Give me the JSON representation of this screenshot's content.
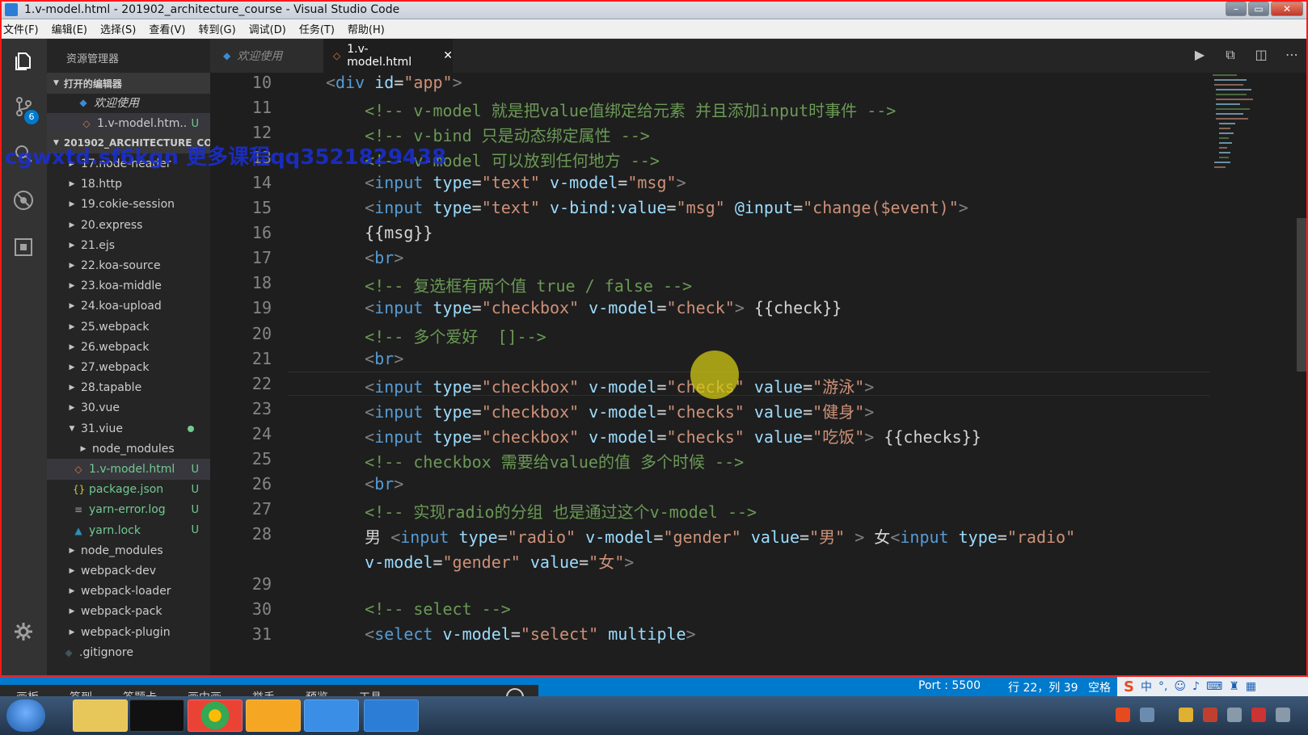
{
  "window": {
    "title": "1.v-model.html - 201902_architecture_course - Visual Studio Code",
    "minimize_glyph": "–",
    "maximize_glyph": "▭",
    "close_glyph": "✕"
  },
  "menu": {
    "items": [
      "文件(F)",
      "编辑(E)",
      "选择(S)",
      "查看(V)",
      "转到(G)",
      "调试(D)",
      "任务(T)",
      "帮助(H)"
    ]
  },
  "activity_bar": {
    "icons": [
      "explorer-icon",
      "source-control-icon",
      "search-icon",
      "debug-icon",
      "extensions-icon",
      "gear-icon"
    ],
    "scm_badge": "6"
  },
  "sidebar": {
    "title": "资源管理器",
    "open_editors_header": "打开的编辑器",
    "open_editors": [
      {
        "label": "欢迎使用",
        "status": ""
      },
      {
        "label": "1.v-model.htm..",
        "status": "U"
      }
    ],
    "workspace_header": "201902_ARCHITECTURE_COU...",
    "tree": [
      {
        "label": "17.node-header",
        "status": "",
        "icon": "folder"
      },
      {
        "label": "18.http",
        "status": "",
        "icon": "folder"
      },
      {
        "label": "19.cokie-session",
        "status": "",
        "icon": "folder"
      },
      {
        "label": "20.express",
        "status": "",
        "icon": "folder"
      },
      {
        "label": "21.ejs",
        "status": "",
        "icon": "folder"
      },
      {
        "label": "22.koa-source",
        "status": "",
        "icon": "folder"
      },
      {
        "label": "23.koa-middle",
        "status": "",
        "icon": "folder"
      },
      {
        "label": "24.koa-upload",
        "status": "",
        "icon": "folder"
      },
      {
        "label": "25.webpack",
        "status": "",
        "icon": "folder"
      },
      {
        "label": "26.webpack",
        "status": "",
        "icon": "folder"
      },
      {
        "label": "27.webpack",
        "status": "",
        "icon": "folder"
      },
      {
        "label": "28.tapable",
        "status": "",
        "icon": "folder"
      },
      {
        "label": "30.vue",
        "status": "",
        "icon": "folder"
      },
      {
        "label": "31.viue",
        "status": "dot",
        "icon": "folder-open"
      },
      {
        "label": "node_modules",
        "status": "",
        "icon": "folder"
      },
      {
        "label": "1.v-model.html",
        "status": "U",
        "icon": "html"
      },
      {
        "label": "package.json",
        "status": "U",
        "icon": "json"
      },
      {
        "label": "yarn-error.log",
        "status": "U",
        "icon": "log"
      },
      {
        "label": "yarn.lock",
        "status": "U",
        "icon": "yarn"
      },
      {
        "label": "node_modules",
        "status": "",
        "icon": "folder"
      },
      {
        "label": "webpack-dev",
        "status": "",
        "icon": "folder"
      },
      {
        "label": "webpack-loader",
        "status": "",
        "icon": "folder"
      },
      {
        "label": "webpack-pack",
        "status": "",
        "icon": "folder"
      },
      {
        "label": "webpack-plugin",
        "status": "",
        "icon": "folder"
      },
      {
        "label": ".gitignore",
        "status": "",
        "icon": "git"
      }
    ]
  },
  "tabs": [
    {
      "label": "欢迎使用",
      "active": false
    },
    {
      "label": "1.v-model.html",
      "active": true,
      "close": "✕"
    }
  ],
  "editor": {
    "line_numbers": [
      "10",
      "11",
      "12",
      "13",
      "14",
      "15",
      "16",
      "17",
      "18",
      "19",
      "20",
      "21",
      "22",
      "23",
      "24",
      "25",
      "26",
      "27",
      "28",
      "",
      "29",
      "30",
      "31"
    ],
    "lines": [
      [
        {
          "t": "pun",
          "v": "<"
        },
        {
          "t": "tag",
          "v": "div"
        },
        {
          "t": "txt",
          "v": " "
        },
        {
          "t": "attr",
          "v": "id"
        },
        {
          "t": "txt",
          "v": "="
        },
        {
          "t": "str",
          "v": "\"app\""
        },
        {
          "t": "pun",
          "v": ">"
        }
      ],
      [
        {
          "t": "txt",
          "v": "    "
        },
        {
          "t": "com",
          "v": "<!-- v-model 就是把value值绑定给元素 并且添加input时事件 -->"
        }
      ],
      [
        {
          "t": "txt",
          "v": "    "
        },
        {
          "t": "com",
          "v": "<!-- v-bind 只是动态绑定属性 -->"
        }
      ],
      [
        {
          "t": "txt",
          "v": "    "
        },
        {
          "t": "com",
          "v": "<!-- v-model 可以放到任何地方 -->"
        }
      ],
      [
        {
          "t": "txt",
          "v": "    "
        },
        {
          "t": "pun",
          "v": "<"
        },
        {
          "t": "tag",
          "v": "input"
        },
        {
          "t": "txt",
          "v": " "
        },
        {
          "t": "attr",
          "v": "type"
        },
        {
          "t": "txt",
          "v": "="
        },
        {
          "t": "str",
          "v": "\"text\""
        },
        {
          "t": "txt",
          "v": " "
        },
        {
          "t": "attr",
          "v": "v-model"
        },
        {
          "t": "txt",
          "v": "="
        },
        {
          "t": "str",
          "v": "\"msg\""
        },
        {
          "t": "pun",
          "v": ">"
        }
      ],
      [
        {
          "t": "txt",
          "v": "    "
        },
        {
          "t": "pun",
          "v": "<"
        },
        {
          "t": "tag",
          "v": "input"
        },
        {
          "t": "txt",
          "v": " "
        },
        {
          "t": "attr",
          "v": "type"
        },
        {
          "t": "txt",
          "v": "="
        },
        {
          "t": "str",
          "v": "\"text\""
        },
        {
          "t": "txt",
          "v": " "
        },
        {
          "t": "attr",
          "v": "v-bind:value"
        },
        {
          "t": "txt",
          "v": "="
        },
        {
          "t": "str",
          "v": "\"msg\""
        },
        {
          "t": "txt",
          "v": " "
        },
        {
          "t": "attr",
          "v": "@input"
        },
        {
          "t": "txt",
          "v": "="
        },
        {
          "t": "str",
          "v": "\"change($event)\""
        },
        {
          "t": "pun",
          "v": ">"
        }
      ],
      [
        {
          "t": "txt",
          "v": "    {{msg}}"
        }
      ],
      [
        {
          "t": "txt",
          "v": "    "
        },
        {
          "t": "pun",
          "v": "<"
        },
        {
          "t": "tag",
          "v": "br"
        },
        {
          "t": "pun",
          "v": ">"
        }
      ],
      [
        {
          "t": "txt",
          "v": "    "
        },
        {
          "t": "com",
          "v": "<!-- 复选框有两个值 true / false -->"
        }
      ],
      [
        {
          "t": "txt",
          "v": "    "
        },
        {
          "t": "pun",
          "v": "<"
        },
        {
          "t": "tag",
          "v": "input"
        },
        {
          "t": "txt",
          "v": " "
        },
        {
          "t": "attr",
          "v": "type"
        },
        {
          "t": "txt",
          "v": "="
        },
        {
          "t": "str",
          "v": "\"checkbox\""
        },
        {
          "t": "txt",
          "v": " "
        },
        {
          "t": "attr",
          "v": "v-model"
        },
        {
          "t": "txt",
          "v": "="
        },
        {
          "t": "str",
          "v": "\"check\""
        },
        {
          "t": "pun",
          "v": ">"
        },
        {
          "t": "txt",
          "v": " {{check}}"
        }
      ],
      [
        {
          "t": "txt",
          "v": "    "
        },
        {
          "t": "com",
          "v": "<!-- 多个爱好  []-->"
        }
      ],
      [
        {
          "t": "txt",
          "v": "    "
        },
        {
          "t": "pun",
          "v": "<"
        },
        {
          "t": "tag",
          "v": "br"
        },
        {
          "t": "pun",
          "v": ">"
        }
      ],
      [
        {
          "t": "txt",
          "v": "    "
        },
        {
          "t": "pun",
          "v": "<"
        },
        {
          "t": "tag",
          "v": "input"
        },
        {
          "t": "txt",
          "v": " "
        },
        {
          "t": "attr",
          "v": "type"
        },
        {
          "t": "txt",
          "v": "="
        },
        {
          "t": "str",
          "v": "\"checkbox\""
        },
        {
          "t": "txt",
          "v": " "
        },
        {
          "t": "attr",
          "v": "v-model"
        },
        {
          "t": "txt",
          "v": "="
        },
        {
          "t": "str",
          "v": "\"checks\""
        },
        {
          "t": "txt",
          "v": " "
        },
        {
          "t": "attr",
          "v": "value"
        },
        {
          "t": "txt",
          "v": "="
        },
        {
          "t": "str",
          "v": "\"游泳\""
        },
        {
          "t": "pun",
          "v": ">"
        }
      ],
      [
        {
          "t": "txt",
          "v": "    "
        },
        {
          "t": "pun",
          "v": "<"
        },
        {
          "t": "tag",
          "v": "input"
        },
        {
          "t": "txt",
          "v": " "
        },
        {
          "t": "attr",
          "v": "type"
        },
        {
          "t": "txt",
          "v": "="
        },
        {
          "t": "str",
          "v": "\"checkbox\""
        },
        {
          "t": "txt",
          "v": " "
        },
        {
          "t": "attr",
          "v": "v-model"
        },
        {
          "t": "txt",
          "v": "="
        },
        {
          "t": "str",
          "v": "\"checks\""
        },
        {
          "t": "txt",
          "v": " "
        },
        {
          "t": "attr",
          "v": "value"
        },
        {
          "t": "txt",
          "v": "="
        },
        {
          "t": "str",
          "v": "\"健身\""
        },
        {
          "t": "pun",
          "v": ">"
        }
      ],
      [
        {
          "t": "txt",
          "v": "    "
        },
        {
          "t": "pun",
          "v": "<"
        },
        {
          "t": "tag",
          "v": "input"
        },
        {
          "t": "txt",
          "v": " "
        },
        {
          "t": "attr",
          "v": "type"
        },
        {
          "t": "txt",
          "v": "="
        },
        {
          "t": "str",
          "v": "\"checkbox\""
        },
        {
          "t": "txt",
          "v": " "
        },
        {
          "t": "attr",
          "v": "v-model"
        },
        {
          "t": "txt",
          "v": "="
        },
        {
          "t": "str",
          "v": "\"checks\""
        },
        {
          "t": "txt",
          "v": " "
        },
        {
          "t": "attr",
          "v": "value"
        },
        {
          "t": "txt",
          "v": "="
        },
        {
          "t": "str",
          "v": "\"吃饭\""
        },
        {
          "t": "pun",
          "v": ">"
        },
        {
          "t": "txt",
          "v": " {{checks}}"
        }
      ],
      [
        {
          "t": "txt",
          "v": "    "
        },
        {
          "t": "com",
          "v": "<!-- checkbox 需要给value的值 多个时候 -->"
        }
      ],
      [
        {
          "t": "txt",
          "v": "    "
        },
        {
          "t": "pun",
          "v": "<"
        },
        {
          "t": "tag",
          "v": "br"
        },
        {
          "t": "pun",
          "v": ">"
        }
      ],
      [
        {
          "t": "txt",
          "v": "    "
        },
        {
          "t": "com",
          "v": "<!-- 实现radio的分组 也是通过这个v-model -->"
        }
      ],
      [
        {
          "t": "txt",
          "v": "    男 "
        },
        {
          "t": "pun",
          "v": "<"
        },
        {
          "t": "tag",
          "v": "input"
        },
        {
          "t": "txt",
          "v": " "
        },
        {
          "t": "attr",
          "v": "type"
        },
        {
          "t": "txt",
          "v": "="
        },
        {
          "t": "str",
          "v": "\"radio\""
        },
        {
          "t": "txt",
          "v": " "
        },
        {
          "t": "attr",
          "v": "v-model"
        },
        {
          "t": "txt",
          "v": "="
        },
        {
          "t": "str",
          "v": "\"gender\""
        },
        {
          "t": "txt",
          "v": " "
        },
        {
          "t": "attr",
          "v": "value"
        },
        {
          "t": "txt",
          "v": "="
        },
        {
          "t": "str",
          "v": "\"男\""
        },
        {
          "t": "txt",
          "v": " "
        },
        {
          "t": "pun",
          "v": ">"
        },
        {
          "t": "txt",
          "v": " 女"
        },
        {
          "t": "pun",
          "v": "<"
        },
        {
          "t": "tag",
          "v": "input"
        },
        {
          "t": "txt",
          "v": " "
        },
        {
          "t": "attr",
          "v": "type"
        },
        {
          "t": "txt",
          "v": "="
        },
        {
          "t": "str",
          "v": "\"radio\""
        }
      ],
      [
        {
          "t": "txt",
          "v": "    "
        },
        {
          "t": "attr",
          "v": "v-model"
        },
        {
          "t": "txt",
          "v": "="
        },
        {
          "t": "str",
          "v": "\"gender\""
        },
        {
          "t": "txt",
          "v": " "
        },
        {
          "t": "attr",
          "v": "value"
        },
        {
          "t": "txt",
          "v": "="
        },
        {
          "t": "str",
          "v": "\"女\""
        },
        {
          "t": "pun",
          "v": ">"
        }
      ],
      [],
      [
        {
          "t": "txt",
          "v": "    "
        },
        {
          "t": "com",
          "v": "<!-- select -->"
        }
      ],
      [
        {
          "t": "txt",
          "v": "    "
        },
        {
          "t": "pun",
          "v": "<"
        },
        {
          "t": "tag",
          "v": "select"
        },
        {
          "t": "txt",
          "v": " "
        },
        {
          "t": "attr",
          "v": "v-model"
        },
        {
          "t": "txt",
          "v": "="
        },
        {
          "t": "str",
          "v": "\"select\""
        },
        {
          "t": "txt",
          "v": " "
        },
        {
          "t": "attr",
          "v": "multiple"
        },
        {
          "t": "pun",
          "v": ">"
        }
      ]
    ]
  },
  "watermark": "cgwxtd.sf6kgn 更多课程qq3521829438",
  "statusbar": {
    "port": "Port : 5500",
    "position": "行 22，列 39",
    "indent": "空格"
  },
  "ime": {
    "logo": "S",
    "mode": "中"
  },
  "recorder": {
    "items": [
      "画板",
      "签到",
      "答题卡",
      "画中画",
      "举手",
      "预览",
      "工具"
    ]
  },
  "colors": {
    "accent": "#007acc",
    "editor_bg": "#1e1e1e",
    "sidebar_bg": "#252526",
    "recording_frame": "#ff1a1a"
  }
}
